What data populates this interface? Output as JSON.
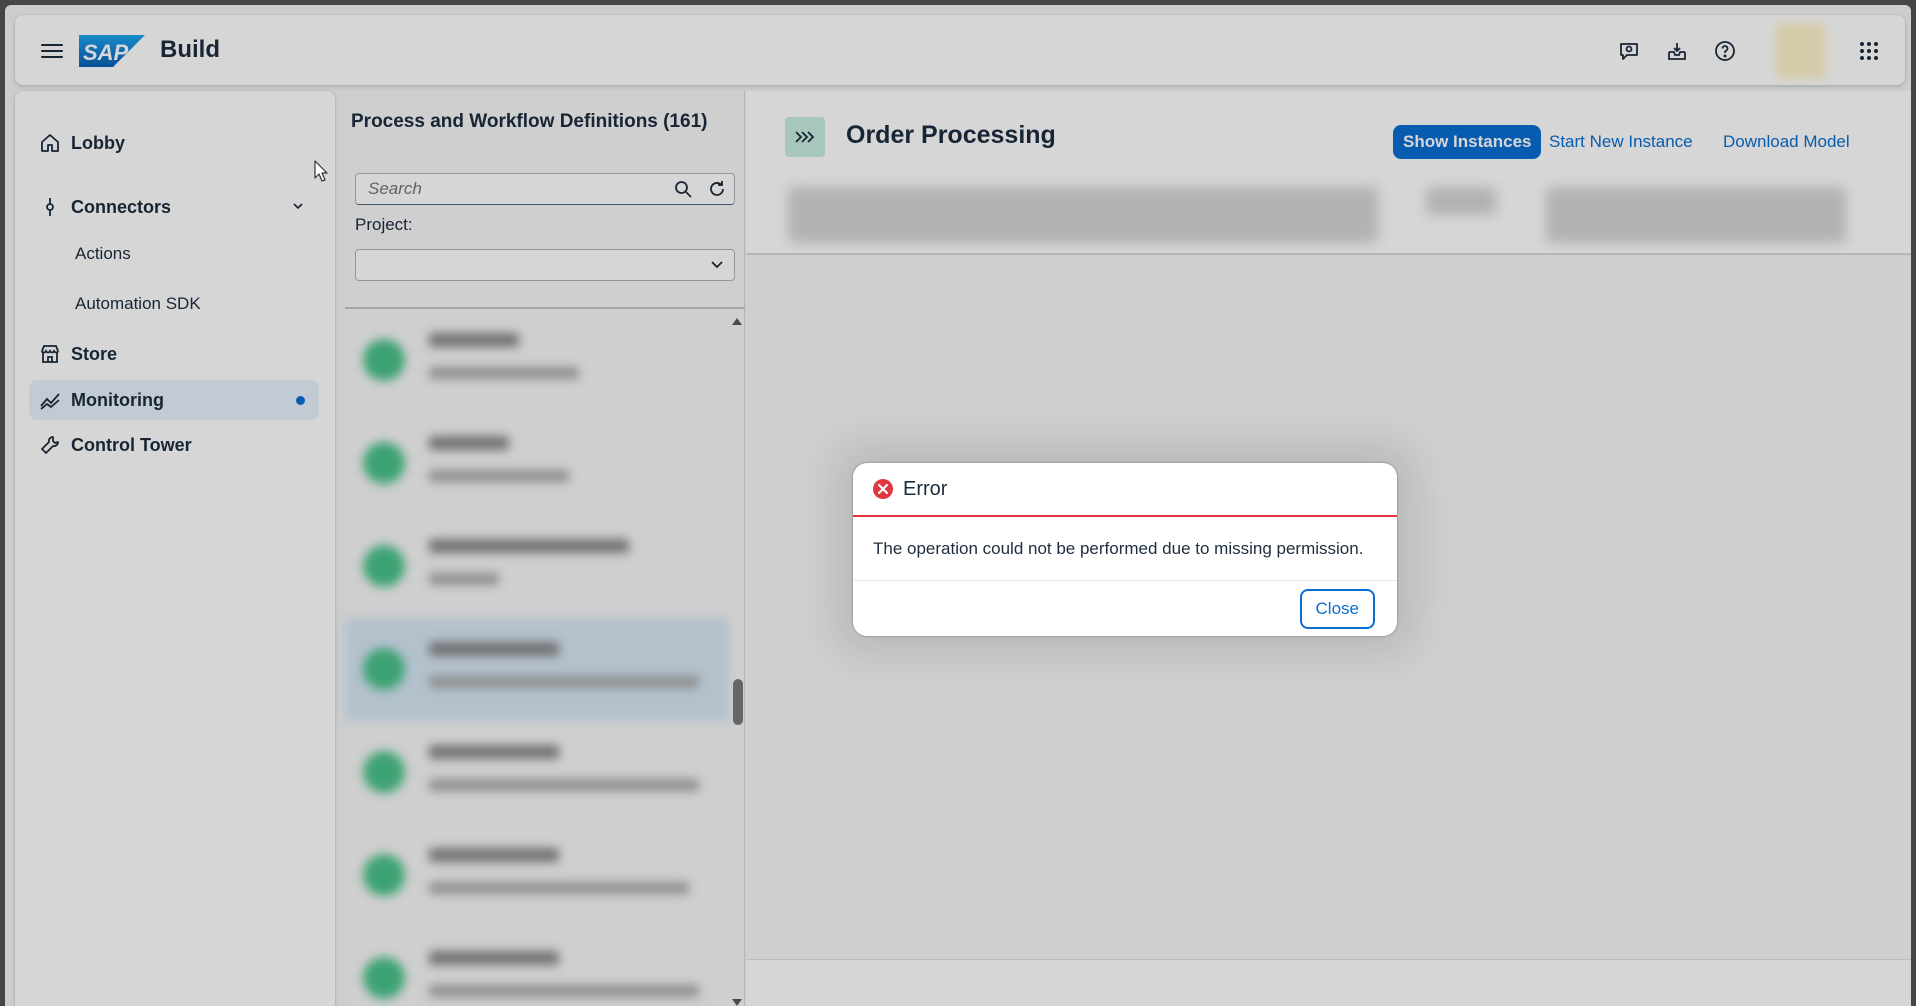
{
  "shell": {
    "brand": "Build",
    "logo_text": "SAP"
  },
  "sidebar": {
    "items": [
      {
        "label": "Lobby",
        "icon": "home-icon"
      },
      {
        "label": "Connectors",
        "icon": "connector-icon",
        "expanded": true,
        "children": [
          {
            "label": "Actions"
          },
          {
            "label": "Automation SDK"
          }
        ]
      },
      {
        "label": "Store",
        "icon": "store-icon"
      },
      {
        "label": "Monitoring",
        "icon": "line-chart-icon",
        "active": true
      },
      {
        "label": "Control Tower",
        "icon": "wrench-icon"
      }
    ]
  },
  "master": {
    "title": "Process and Workflow Definitions (161)",
    "search_placeholder": "Search",
    "project_label": "Project:",
    "project_value": ""
  },
  "detail": {
    "title": "Order Processing",
    "actions": {
      "show_instances": "Show Instances",
      "start_new_instance": "Start New Instance",
      "download_model": "Download Model"
    }
  },
  "dialog": {
    "title": "Error",
    "message": "The operation could not be performed due to missing permission.",
    "close_label": "Close"
  },
  "colors": {
    "accent": "#0a6ed1",
    "error": "#e0383e",
    "text": "#1d2d3e",
    "active_nav_bg": "#e8f2fc"
  }
}
